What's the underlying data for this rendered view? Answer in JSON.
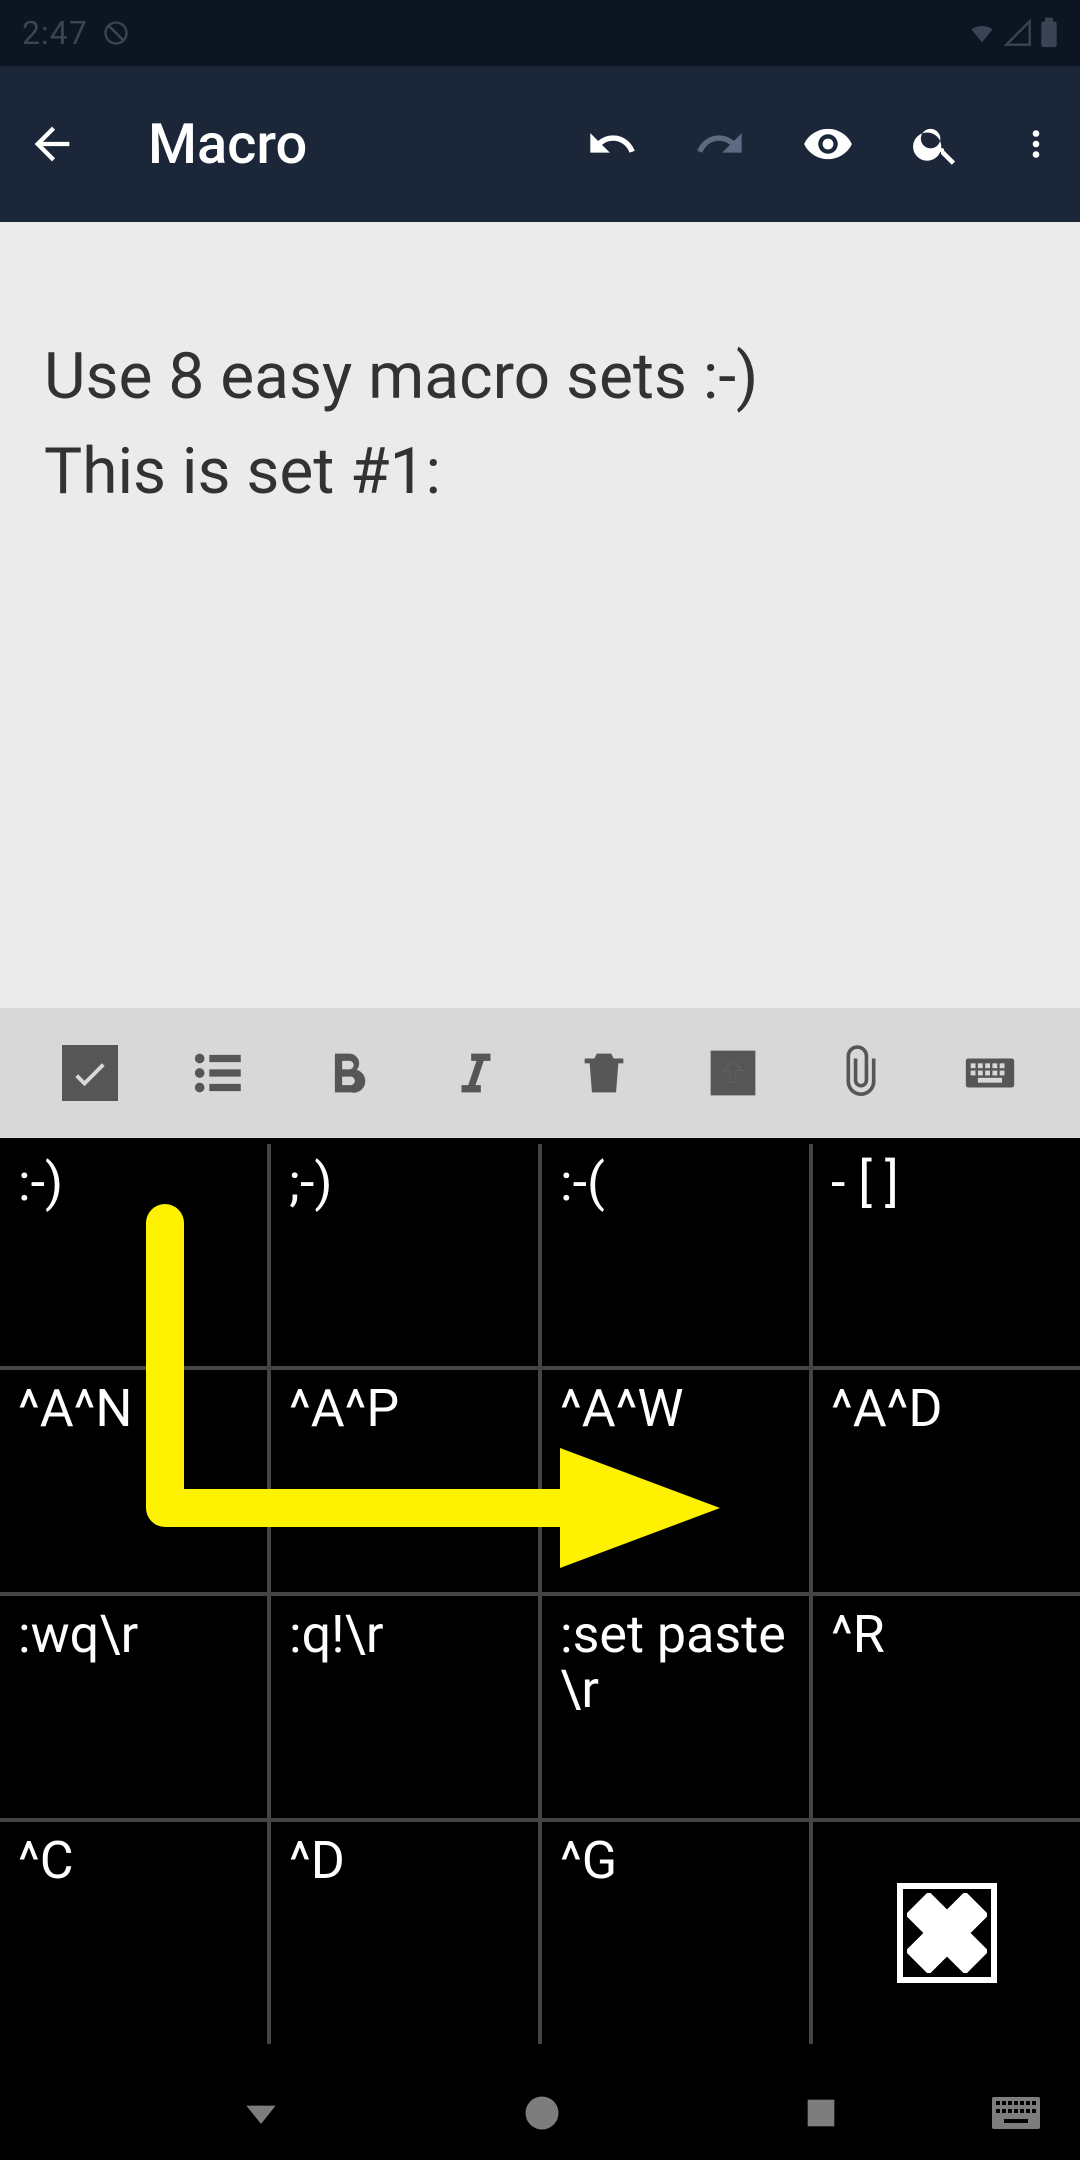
{
  "status": {
    "time": "2:47"
  },
  "appbar": {
    "title": "Macro"
  },
  "editor": {
    "text": "Use 8 easy macro sets :-)\nThis is set #1:"
  },
  "macro": {
    "rows": [
      [
        ":-)",
        ";-)",
        ":-(",
        "- [ ]"
      ],
      [
        "^A^N",
        "^A^P",
        "^A^W",
        "^A^D"
      ],
      [
        ":wq\\r",
        ":q!\\r",
        ":set paste\\r",
        "^R"
      ],
      [
        "^C",
        "^D",
        "^G",
        ""
      ]
    ]
  }
}
